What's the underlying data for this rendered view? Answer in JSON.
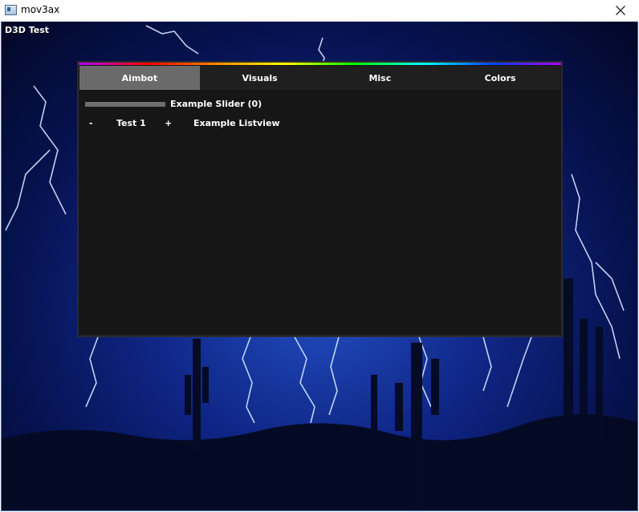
{
  "window": {
    "title": "mov3ax",
    "close_icon": "close-icon"
  },
  "overlay": {
    "label": "D3D Test"
  },
  "menu": {
    "tabs": [
      {
        "label": "Aimbot",
        "active": true
      },
      {
        "label": "Visuals",
        "active": false
      },
      {
        "label": "Misc",
        "active": false
      },
      {
        "label": "Colors",
        "active": false
      }
    ],
    "slider": {
      "label": "Example Slider (0)",
      "value": 0
    },
    "listview": {
      "minus": "-",
      "value": "Test 1",
      "plus": "+",
      "label": "Example Listview"
    }
  },
  "colors": {
    "panel": "#161616",
    "tab_active": "#6a6a6a",
    "tab_bar": "#1f1f1f",
    "text": "#ffffff"
  }
}
